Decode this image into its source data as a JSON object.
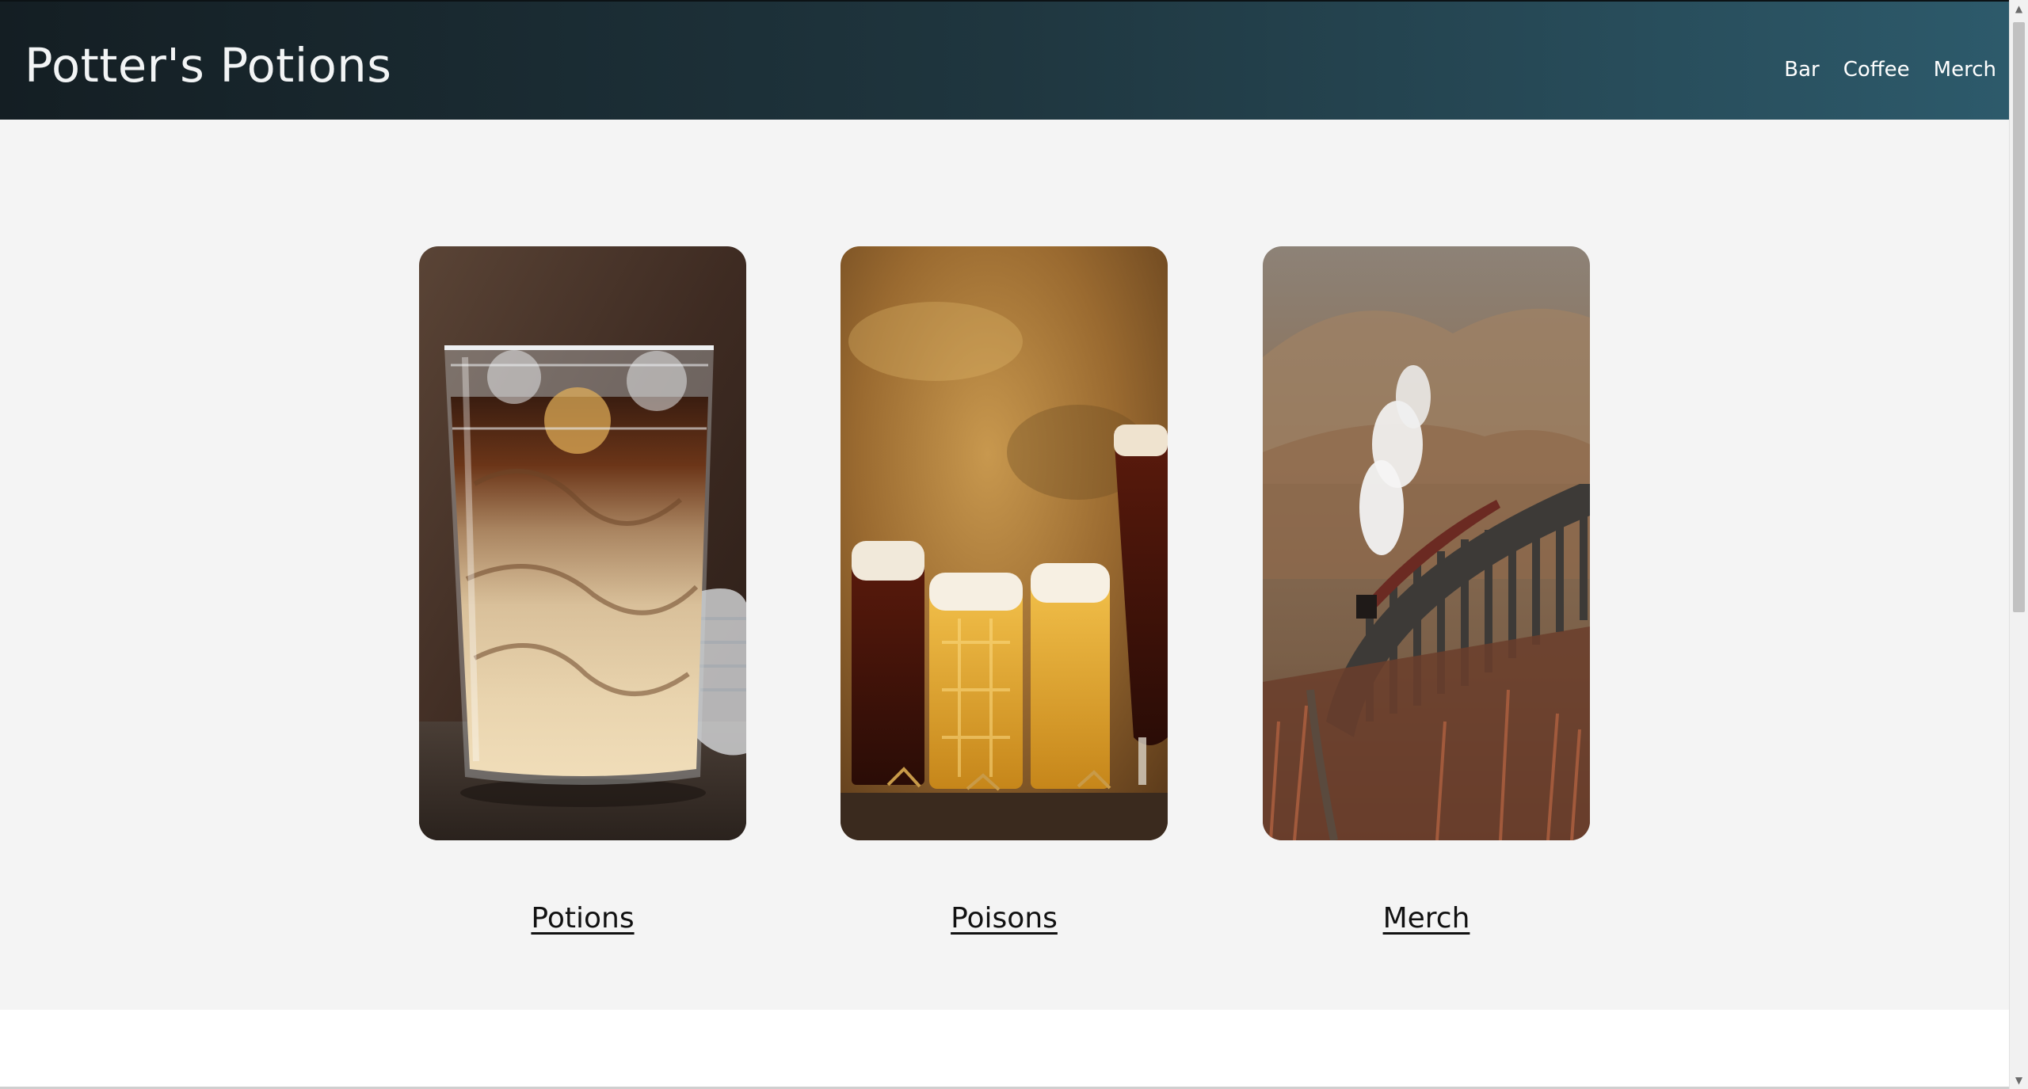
{
  "header": {
    "site_title": "Potter's Potions",
    "nav": [
      "Bar",
      "Coffee",
      "Merch"
    ]
  },
  "cards": [
    {
      "label": "Potions",
      "image": "iced-coffee-glass"
    },
    {
      "label": "Poisons",
      "image": "beer-glasses"
    },
    {
      "label": "Merch",
      "image": "steam-train-viaduct"
    }
  ],
  "colors": {
    "header_dark": "#141e23",
    "header_light": "#2d5a6b",
    "page_background": "#f4f4f4",
    "link_text": "#111111"
  },
  "icons": {
    "scroll_up": "triangle-up-icon",
    "scroll_down": "triangle-down-icon"
  }
}
